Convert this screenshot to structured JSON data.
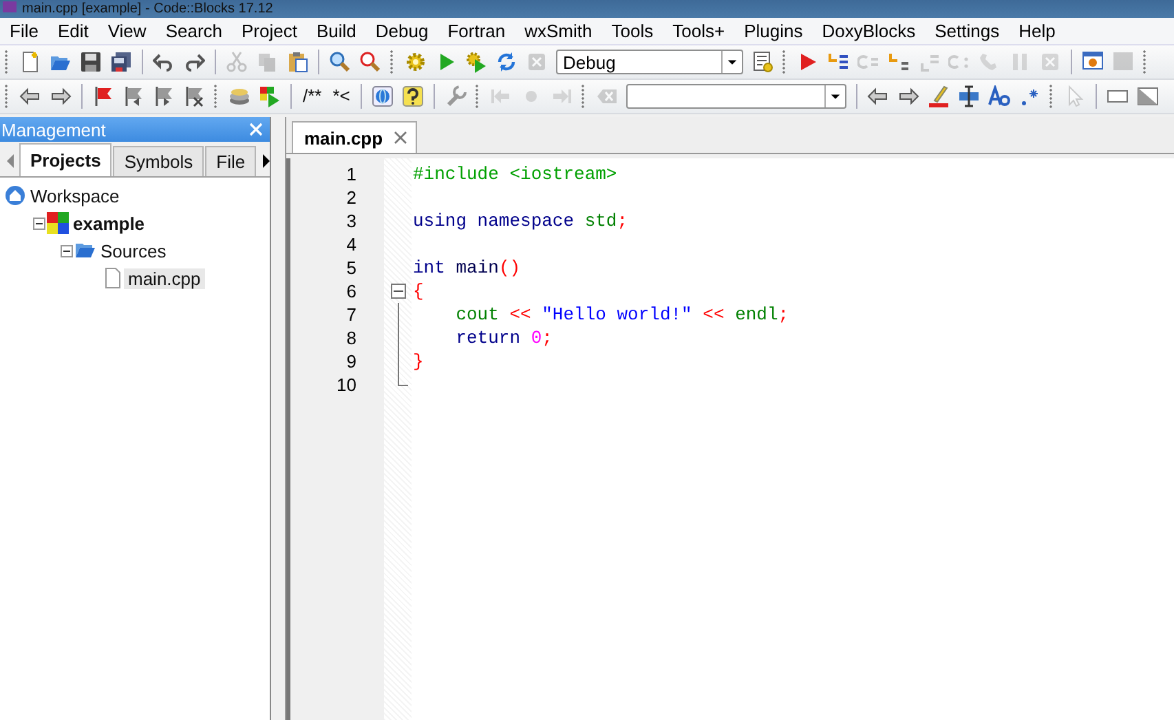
{
  "window": {
    "title": "main.cpp [example] - Code::Blocks 17.12"
  },
  "menu": [
    "File",
    "Edit",
    "View",
    "Search",
    "Project",
    "Build",
    "Debug",
    "Fortran",
    "wxSmith",
    "Tools",
    "Tools+",
    "Plugins",
    "DoxyBlocks",
    "Settings",
    "Help"
  ],
  "toolbars": [
    {
      "items": [
        {
          "kind": "grip"
        },
        {
          "kind": "button",
          "disabled": false
        },
        {
          "kind": "button",
          "disabled": false
        },
        {
          "kind": "button",
          "disabled": false
        },
        {
          "kind": "button",
          "disabled": false
        },
        {
          "kind": "sep"
        },
        {
          "kind": "button",
          "disabled": false
        },
        {
          "kind": "button",
          "disabled": false
        },
        {
          "kind": "sep"
        },
        {
          "kind": "button",
          "disabled": true
        },
        {
          "kind": "button",
          "disabled": true
        },
        {
          "kind": "button",
          "disabled": false
        },
        {
          "kind": "sep"
        },
        {
          "kind": "button",
          "disabled": false
        },
        {
          "kind": "button",
          "disabled": false
        },
        {
          "kind": "grip"
        },
        {
          "kind": "button",
          "disabled": false
        },
        {
          "kind": "button",
          "disabled": false
        },
        {
          "kind": "button",
          "disabled": false
        },
        {
          "kind": "button",
          "disabled": false
        },
        {
          "kind": "button",
          "disabled": true
        },
        {
          "kind": "combo",
          "value": "Debug"
        },
        {
          "kind": "button",
          "disabled": false
        },
        {
          "kind": "grip"
        },
        {
          "kind": "button",
          "disabled": false
        },
        {
          "kind": "button",
          "disabled": false
        },
        {
          "kind": "button",
          "disabled": true
        },
        {
          "kind": "button",
          "disabled": false
        },
        {
          "kind": "button",
          "disabled": true
        },
        {
          "kind": "button",
          "disabled": true
        },
        {
          "kind": "button",
          "disabled": true
        },
        {
          "kind": "button",
          "disabled": true
        },
        {
          "kind": "button",
          "disabled": true
        },
        {
          "kind": "sep"
        },
        {
          "kind": "button",
          "disabled": false
        },
        {
          "kind": "button",
          "disabled": true
        },
        {
          "kind": "grip"
        }
      ]
    },
    {
      "items": [
        {
          "kind": "grip"
        },
        {
          "kind": "button",
          "disabled": false
        },
        {
          "kind": "button",
          "disabled": false
        },
        {
          "kind": "sep"
        },
        {
          "kind": "button",
          "disabled": false
        },
        {
          "kind": "button",
          "disabled": false
        },
        {
          "kind": "button",
          "disabled": false
        },
        {
          "kind": "button",
          "disabled": false
        },
        {
          "kind": "grip"
        },
        {
          "kind": "button",
          "disabled": false
        },
        {
          "kind": "button",
          "disabled": false
        },
        {
          "kind": "sep"
        },
        {
          "kind": "text",
          "label": "/**"
        },
        {
          "kind": "text",
          "label": "*<"
        },
        {
          "kind": "sep"
        },
        {
          "kind": "button",
          "disabled": false
        },
        {
          "kind": "button",
          "disabled": false
        },
        {
          "kind": "sep"
        },
        {
          "kind": "button",
          "disabled": false
        },
        {
          "kind": "grip"
        },
        {
          "kind": "button",
          "disabled": true
        },
        {
          "kind": "button",
          "disabled": true
        },
        {
          "kind": "button",
          "disabled": true
        },
        {
          "kind": "grip"
        },
        {
          "kind": "button",
          "disabled": true
        },
        {
          "kind": "combo"
        },
        {
          "kind": "sep"
        },
        {
          "kind": "button",
          "disabled": false
        },
        {
          "kind": "button",
          "disabled": false
        },
        {
          "kind": "button",
          "disabled": false
        },
        {
          "kind": "button",
          "disabled": false
        },
        {
          "kind": "button",
          "disabled": false
        },
        {
          "kind": "button",
          "disabled": false
        },
        {
          "kind": "grip"
        },
        {
          "kind": "button",
          "disabled": true
        },
        {
          "kind": "sep"
        },
        {
          "kind": "button",
          "disabled": false
        },
        {
          "kind": "button",
          "disabled": false
        }
      ]
    }
  ],
  "management": {
    "title": "Management",
    "tabs": [
      {
        "label": "Projects",
        "selected": true
      },
      {
        "label": "Symbols",
        "selected": false
      },
      {
        "label": "File",
        "selected": false
      }
    ],
    "tree": [
      {
        "label": "Workspace",
        "kind": "workspace",
        "children": [
          {
            "label": "example",
            "kind": "project",
            "active": true,
            "expanded": true,
            "children": [
              {
                "label": "Sources",
                "kind": "folder",
                "expanded": true,
                "children": [
                  {
                    "label": "main.cpp",
                    "kind": "file",
                    "selected": true
                  }
                ]
              }
            ]
          }
        ]
      }
    ]
  },
  "editor": {
    "tabs": [
      {
        "label": "main.cpp",
        "selected": true
      }
    ],
    "lines": [
      {
        "number": "1",
        "tokens": [
          {
            "text": "#include <iostream>",
            "kind": "preprocessor"
          }
        ]
      },
      {
        "number": "2"
      },
      {
        "number": "3",
        "tokens": [
          {
            "text": "using namespace ",
            "kind": "keyword"
          },
          {
            "text": "std",
            "kind": "keyword2"
          },
          {
            "text": ";",
            "kind": "operator"
          }
        ]
      },
      {
        "number": "4"
      },
      {
        "number": "5",
        "tokens": [
          {
            "text": "int ",
            "kind": "keyword"
          },
          {
            "text": "main",
            "kind": "identifier"
          },
          {
            "text": "()",
            "kind": "operator"
          }
        ]
      },
      {
        "number": "6",
        "expanded": true,
        "tokens": [
          {
            "text": "{",
            "kind": "operator"
          }
        ]
      },
      {
        "number": "7",
        "tokens": [
          {
            "text": "    cout ",
            "kind": "keyword2"
          },
          {
            "text": "<< ",
            "kind": "operator"
          },
          {
            "text": "\"Hello world!\" ",
            "kind": "string"
          },
          {
            "text": "<< ",
            "kind": "operator"
          },
          {
            "text": "endl",
            "kind": "keyword2"
          },
          {
            "text": ";",
            "kind": "operator"
          }
        ]
      },
      {
        "number": "8",
        "tokens": [
          {
            "text": "    return ",
            "kind": "keyword"
          },
          {
            "text": "0",
            "kind": "number"
          },
          {
            "text": ";",
            "kind": "operator"
          }
        ]
      },
      {
        "number": "9",
        "tokens": [
          {
            "text": "}",
            "kind": "operator"
          }
        ]
      },
      {
        "number": "10"
      }
    ]
  }
}
